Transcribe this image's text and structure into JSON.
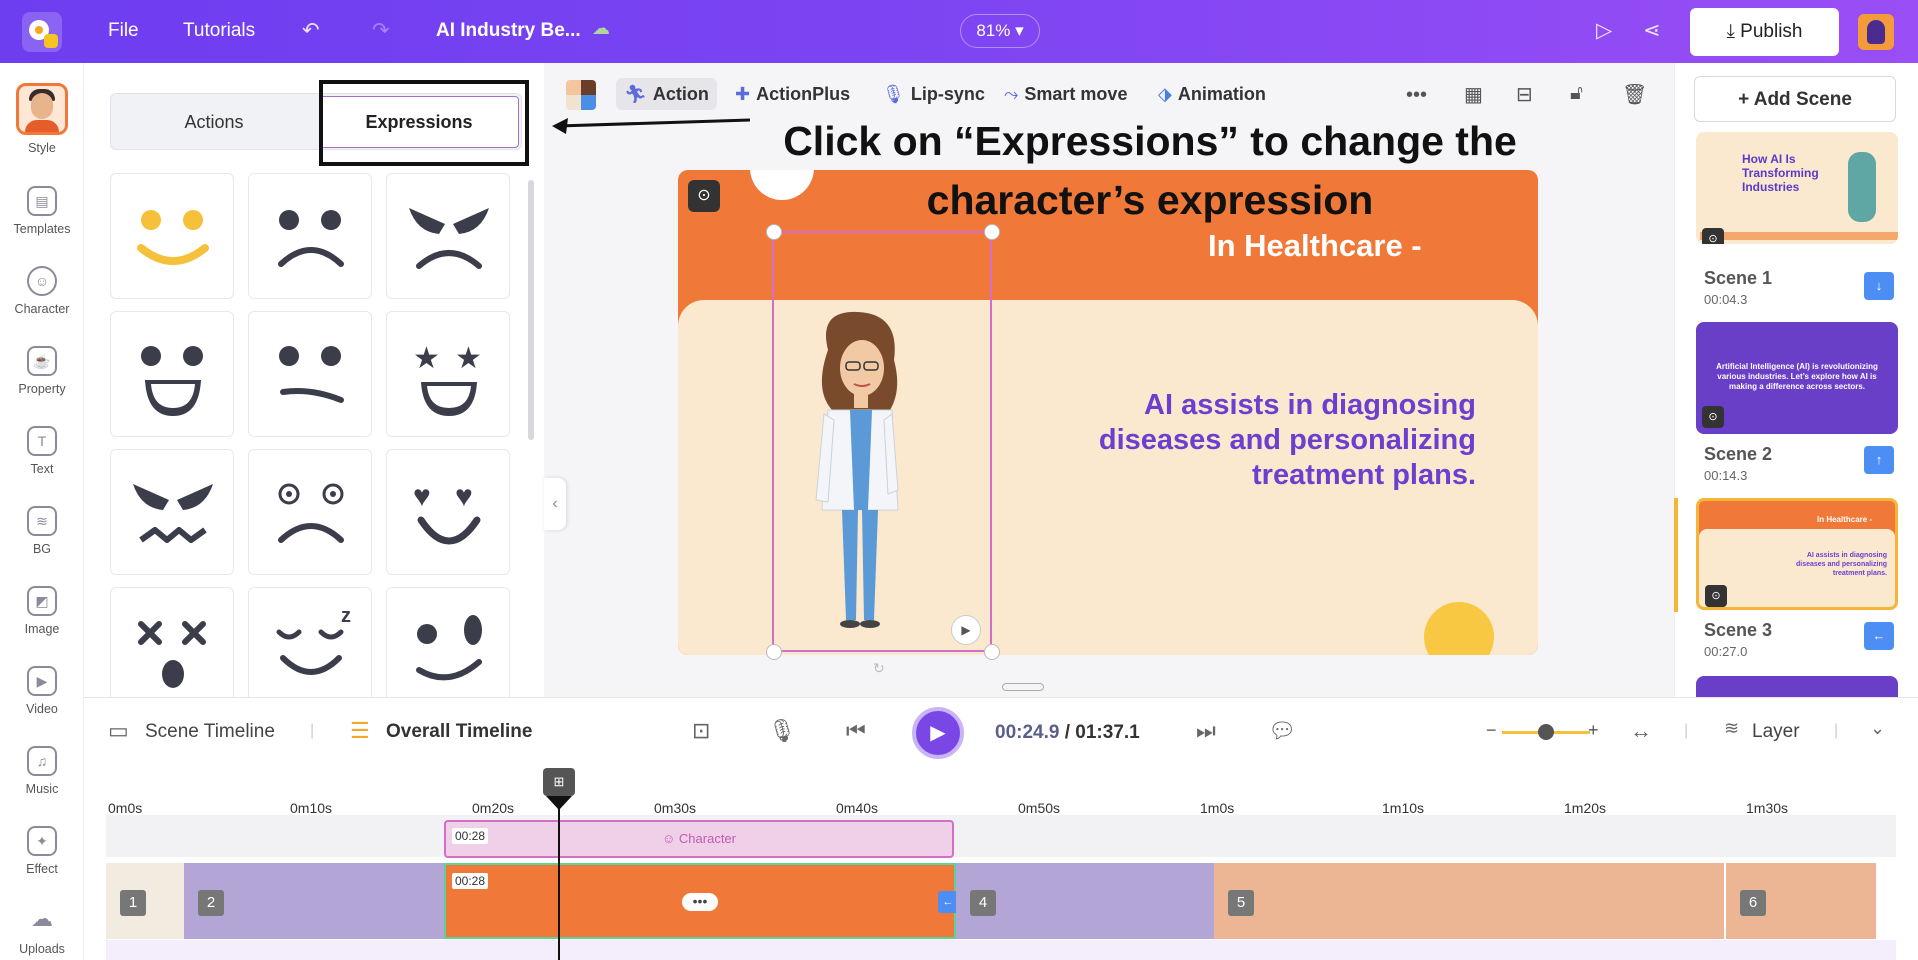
{
  "topbar": {
    "file": "File",
    "tutorials": "Tutorials",
    "project_title": "AI Industry Be...",
    "zoom": "81%",
    "publish": "Publish"
  },
  "rail": {
    "items": [
      {
        "label": "Style",
        "icon": "style-avatar-icon"
      },
      {
        "label": "Templates",
        "icon": "templates-icon"
      },
      {
        "label": "Character",
        "icon": "character-icon"
      },
      {
        "label": "Property",
        "icon": "property-icon"
      },
      {
        "label": "Text",
        "icon": "text-icon"
      },
      {
        "label": "BG",
        "icon": "bg-icon"
      },
      {
        "label": "Image",
        "icon": "image-icon"
      },
      {
        "label": "Video",
        "icon": "video-icon"
      },
      {
        "label": "Music",
        "icon": "music-icon"
      },
      {
        "label": "Effect",
        "icon": "effect-icon"
      },
      {
        "label": "Uploads",
        "icon": "uploads-icon"
      }
    ]
  },
  "panel": {
    "tabs": [
      "Actions",
      "Expressions"
    ],
    "selected_tab": "Expressions",
    "expressions": [
      "smile-yellow",
      "sad",
      "angry",
      "grin",
      "meh",
      "star-eyes",
      "furious",
      "dizzy",
      "love",
      "dead",
      "sleepy",
      "wink"
    ]
  },
  "toolbar": {
    "action": "Action",
    "actionplus": "ActionPlus",
    "lipsync": "Lip-sync",
    "smartmove": "Smart move",
    "animation": "Animation"
  },
  "annotation": {
    "line1": "Click on “Expressions” to change the",
    "line2": "character’s expression"
  },
  "slide": {
    "title": "In Healthcare -",
    "body_line1": "AI assists in diagnosing",
    "body_line2": "diseases and personalizing",
    "body_line3": "treatment plans."
  },
  "scenes": {
    "add_label": "+ Add Scene",
    "list": [
      {
        "label": "Scene 1",
        "time": "00:04.3",
        "thumb_title": "How AI Is Transforming Industries"
      },
      {
        "label": "Scene 2",
        "time": "00:14.3",
        "thumb_text": "Artificial Intelligence (AI) is revolutionizing various industries. Let’s explore how AI is making a difference across sectors."
      },
      {
        "label": "Scene 3",
        "time": "00:27.0",
        "thumb_title": "In Healthcare -",
        "thumb_text": "AI assists in diagnosing diseases and personalizing treatment plans."
      }
    ]
  },
  "timeline": {
    "scene_timeline": "Scene Timeline",
    "overall_timeline": "Overall Timeline",
    "current_time": "00:24.9",
    "separator": " / ",
    "total_time": "01:37.1",
    "layer": "Layer",
    "ruler": [
      "0m0s",
      "0m10s",
      "0m20s",
      "0m30s",
      "0m40s",
      "0m50s",
      "1m0s",
      "1m10s",
      "1m20s",
      "1m30s"
    ],
    "character_track_label": "Character",
    "character_track_time": "00:28",
    "scene_track_time": "00:28",
    "segments": [
      "1",
      "2",
      "3",
      "4",
      "5",
      "6"
    ],
    "zoom_level": 0.55
  },
  "colors": {
    "topbar": "#7444f1",
    "slide_orange": "#f07838",
    "slide_cream": "#fbe9cf",
    "slide_text_purple": "#6c3fcf",
    "selection_pink": "#d46ec9",
    "play_purple": "#7a46e6"
  }
}
